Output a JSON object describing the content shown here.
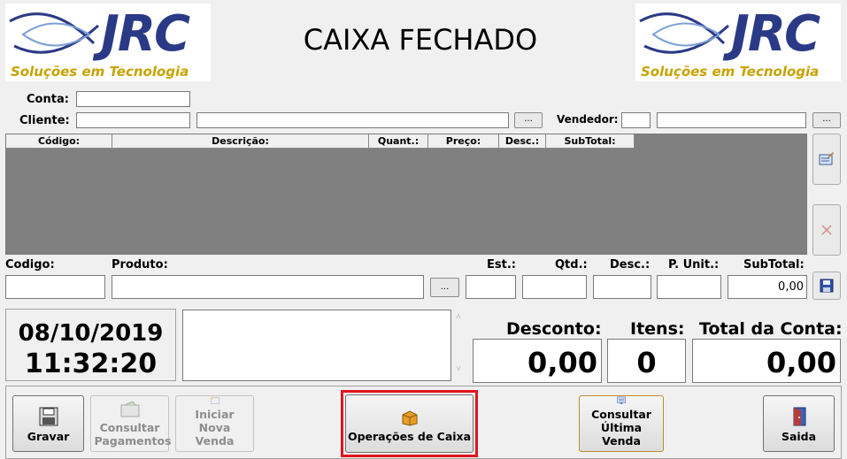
{
  "header": {
    "title": "CAIXA FECHADO",
    "logo_text": "JRC",
    "logo_tagline": "Soluções em Tecnologia"
  },
  "account": {
    "conta_label": "Conta:",
    "conta_value": "",
    "cliente_label": "Cliente:",
    "cliente_code": "",
    "cliente_name": "",
    "vendedor_label": "Vendedor:",
    "vendedor_code": "",
    "vendedor_name": "",
    "lookup_label": "..."
  },
  "items_table": {
    "columns": [
      "Código:",
      "Descrição:",
      "Quant.:",
      "Preço:",
      "Desc.:",
      "SubTotal:"
    ],
    "rows": []
  },
  "entry": {
    "codigo_label": "Codigo:",
    "produto_label": "Produto:",
    "est_label": "Est.:",
    "qtd_label": "Qtd.:",
    "desc_label": "Desc.:",
    "punit_label": "P. Unit.:",
    "subtotal_label": "SubTotal:",
    "subtotal_value": "0,00",
    "lookup_label": "..."
  },
  "datetime": {
    "date": "08/10/2019",
    "time": "11:32:20"
  },
  "totals": {
    "desconto_label": "Desconto:",
    "desconto_value": "0,00",
    "itens_label": "Itens:",
    "itens_value": "0",
    "total_label": "Total da Conta:",
    "total_value": "0,00"
  },
  "toolbar": {
    "gravar": "Gravar",
    "consultar_pagamentos": "Consultar Pagamentos",
    "iniciar_nova_venda": "Iniciar Nova Venda",
    "operacoes_caixa": "Operações de Caixa",
    "consultar_ultima_venda": "Consultar Última Venda",
    "saida": "Saida"
  },
  "colors": {
    "highlight": "#e0141d",
    "grid_bg": "#808080",
    "logo_blue": "#2b3a86",
    "logo_gold": "#c8a200"
  },
  "icons": [
    "fish-logo-icon",
    "edit-row-icon",
    "delete-row-icon",
    "save-icon",
    "floppy-save-icon",
    "payments-icon",
    "new-sale-icon",
    "box-icon",
    "last-sale-icon",
    "exit-door-icon"
  ]
}
